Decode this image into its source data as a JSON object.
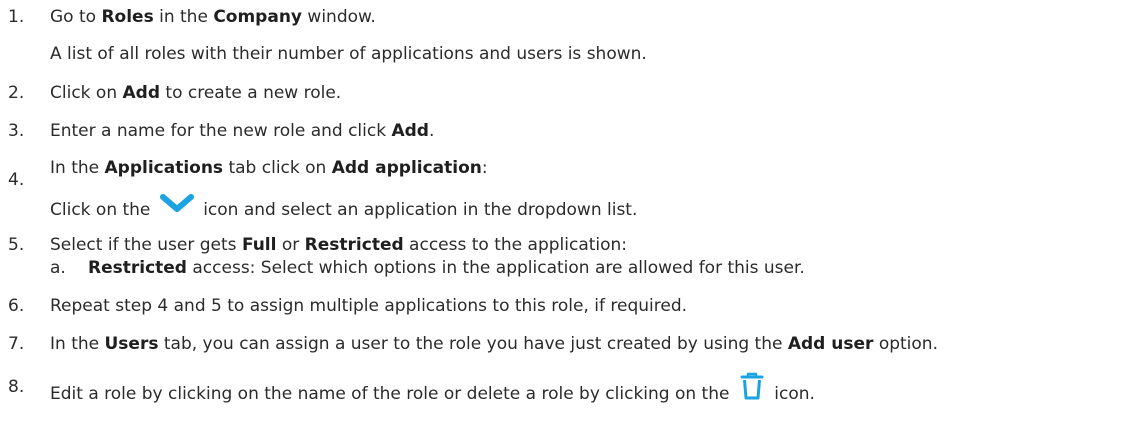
{
  "steps": [
    {
      "num": "1.",
      "parts": [
        {
          "text": "Go to "
        },
        {
          "text": "Roles",
          "bold": true
        },
        {
          "text": " in the "
        },
        {
          "text": "Company",
          "bold": true
        },
        {
          "text": " window."
        }
      ],
      "note": "A list of all roles with their number of applications and users is shown."
    },
    {
      "num": "2.",
      "parts": [
        {
          "text": "Click on "
        },
        {
          "text": "Add",
          "bold": true
        },
        {
          "text": " to create a new role."
        }
      ]
    },
    {
      "num": "3.",
      "parts": [
        {
          "text": "Enter a name for the new role and click "
        },
        {
          "text": "Add",
          "bold": true
        },
        {
          "text": "."
        }
      ]
    },
    {
      "num": "4.",
      "parts": [
        {
          "text": "In the "
        },
        {
          "text": "Applications",
          "bold": true
        },
        {
          "text": " tab click on "
        },
        {
          "text": "Add application",
          "bold": true
        },
        {
          "text": ":"
        }
      ],
      "note_before": "Click on the",
      "note_after": "icon and select an application in the dropdown list."
    },
    {
      "num": "5.",
      "parts": [
        {
          "text": "Select if the user gets "
        },
        {
          "text": "Full",
          "bold": true
        },
        {
          "text": " or "
        },
        {
          "text": "Restricted",
          "bold": true
        },
        {
          "text": " access to the application:"
        }
      ],
      "sub": {
        "label": "a.",
        "bold": "Restricted",
        "text": " access: Select which options in the application are allowed for this user."
      }
    },
    {
      "num": "6.",
      "parts": [
        {
          "text": "Repeat step 4 and 5 to assign multiple applications to this role, if required."
        }
      ]
    },
    {
      "num": "7.",
      "parts": [
        {
          "text": "In the "
        },
        {
          "text": "Users",
          "bold": true
        },
        {
          "text": " tab, you can assign a user to the role you have just created by using the "
        },
        {
          "text": "Add user",
          "bold": true
        },
        {
          "text": " option."
        }
      ]
    },
    {
      "num": "8.",
      "before": "Edit a role by clicking on the name of the role or delete a role by clicking on the",
      "after": "icon."
    }
  ],
  "icons": {
    "chevron": "chevron-down-icon",
    "trash": "trash-icon",
    "color": "#1aa3e0"
  }
}
